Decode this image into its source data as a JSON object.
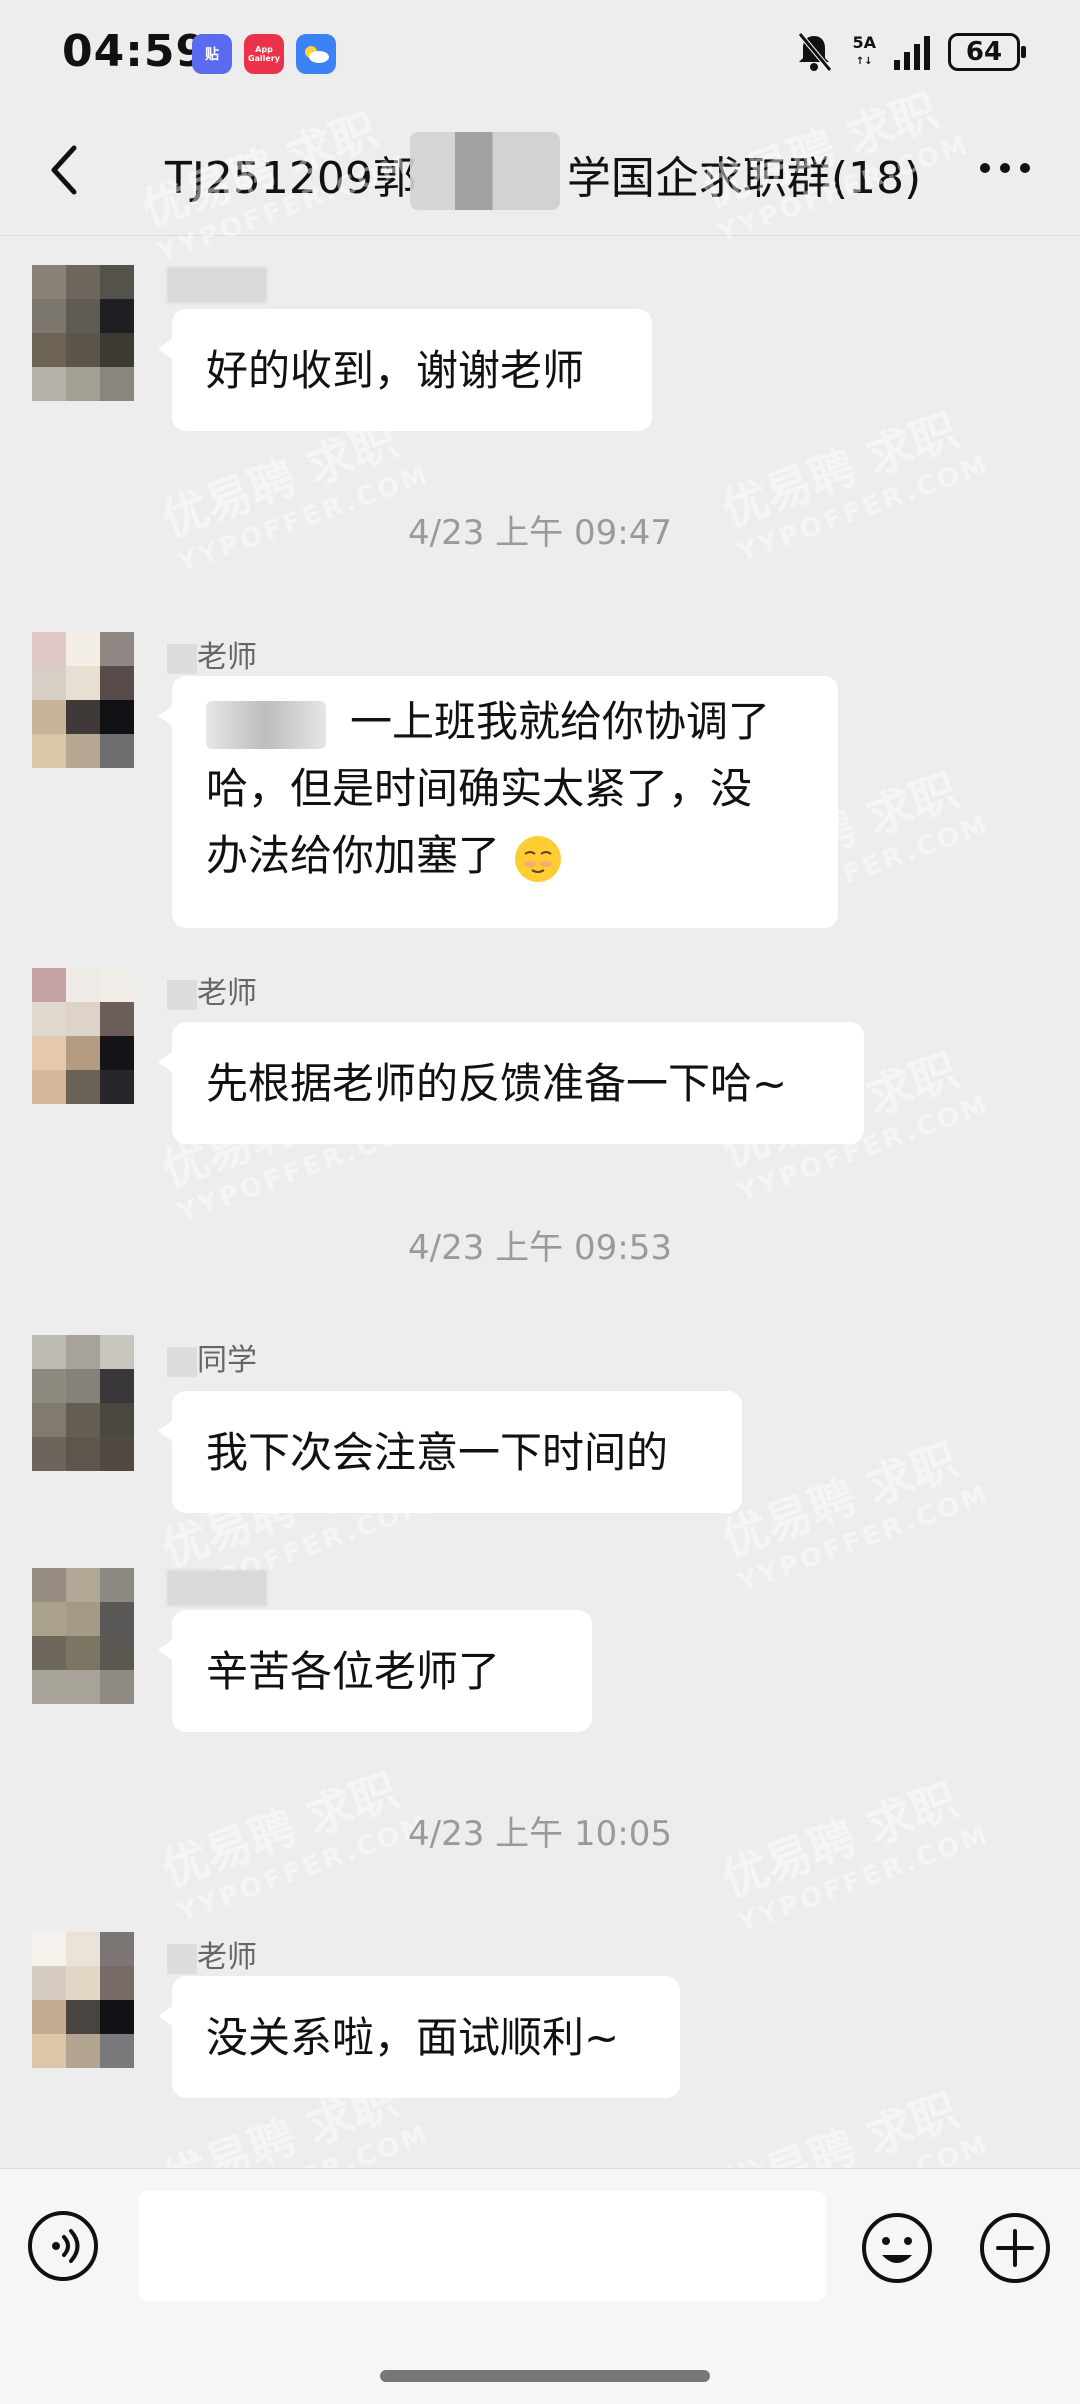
{
  "status_bar": {
    "time": "04:59",
    "apps": [
      {
        "name": "tieba-icon",
        "label": "贴",
        "color": "#5b6bf0"
      },
      {
        "name": "app-gallery-icon",
        "label": "App\nGallery",
        "color": "#e8334a"
      },
      {
        "name": "weather-icon",
        "label": "",
        "color": "#3b82f6"
      }
    ],
    "network": "5A",
    "battery": "64"
  },
  "header": {
    "title": "TJ251209郭",
    "title_suffix": "学国企求职群(18)"
  },
  "messages": [
    {
      "type": "message",
      "sender": "",
      "text": "好的收到，谢谢老师"
    },
    {
      "type": "time",
      "text": "4/23 上午 09:47"
    },
    {
      "type": "message",
      "sender": "老师",
      "text_lines": [
        "一上班我就给你协调了",
        "哈，但是时间确实太紧了，没",
        "办法给你加塞了"
      ]
    },
    {
      "type": "message",
      "sender": "老师",
      "text": "先根据老师的反馈准备一下哈~"
    },
    {
      "type": "time",
      "text": "4/23 上午 09:53"
    },
    {
      "type": "message",
      "sender": "同学",
      "text": "我下次会注意一下时间的"
    },
    {
      "type": "message",
      "sender": "",
      "text": "辛苦各位老师了"
    },
    {
      "type": "time",
      "text": "4/23 上午 10:05"
    },
    {
      "type": "message",
      "sender": "老师",
      "text": "没关系啦，面试顺利~"
    }
  ],
  "watermark": {
    "brand": "优易聘",
    "tag": "求职",
    "url": "YYPOFFER.COM"
  },
  "input_bar": {
    "placeholder": ""
  },
  "colors": {
    "background": "#ededed",
    "bubble": "#ffffff",
    "timestamp": "#9a9a9a"
  }
}
